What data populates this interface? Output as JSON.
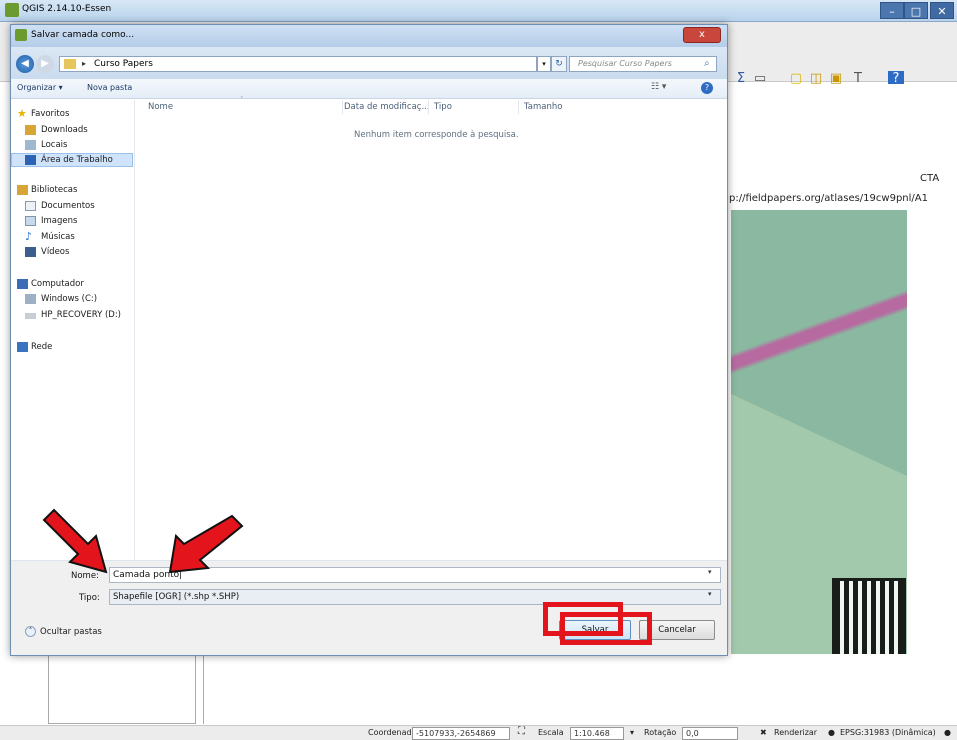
{
  "app": {
    "title": "QGIS 2.14.10-Essen"
  },
  "map": {
    "cta": "CTA",
    "atlas_url": "p://fieldpapers.org/atlases/19cw9pnl/A1"
  },
  "statusbar": {
    "coord_label": "Coordenada",
    "coord_value": "-5107933,-2654869",
    "scale_label": "Escala",
    "scale_value": "1:10.468",
    "rotation_label": "Rotação",
    "rotation_value": "0,0",
    "render_label": "Renderizar",
    "crs_label": "EPSG:31983 (Dinâmica)"
  },
  "dialog": {
    "title": "Salvar camada como...",
    "close": "x",
    "address": "Curso Papers",
    "search_placeholder": "Pesquisar Curso Papers",
    "organize": "Organizar ▾",
    "new_folder": "Nova pasta",
    "nav": {
      "favorites": "Favoritos",
      "downloads": "Downloads",
      "locais": "Locais",
      "desktop": "Área de Trabalho",
      "libraries": "Bibliotecas",
      "documents": "Documentos",
      "images": "Imagens",
      "music": "Músicas",
      "videos": "Vídeos",
      "computer": "Computador",
      "windows_c": "Windows  (C:)",
      "hp_recovery": "HP_RECOVERY (D:)",
      "network": "Rede"
    },
    "columns": {
      "name": "Nome",
      "date": "Data de modificaç...",
      "type": "Tipo",
      "size": "Tamanho"
    },
    "empty_message": "Nenhum item corresponde à pesquisa.",
    "name_label": "Nome:",
    "name_value": "Camada ponto",
    "type_label": "Tipo:",
    "type_value": "Shapefile [OGR] (*.shp *.SHP)",
    "hide_folders": "Ocultar pastas",
    "save": "Salvar",
    "cancel": "Cancelar"
  },
  "colors": {
    "annotation_red": "#e3141b",
    "title_bar": "#b9d3ec"
  }
}
